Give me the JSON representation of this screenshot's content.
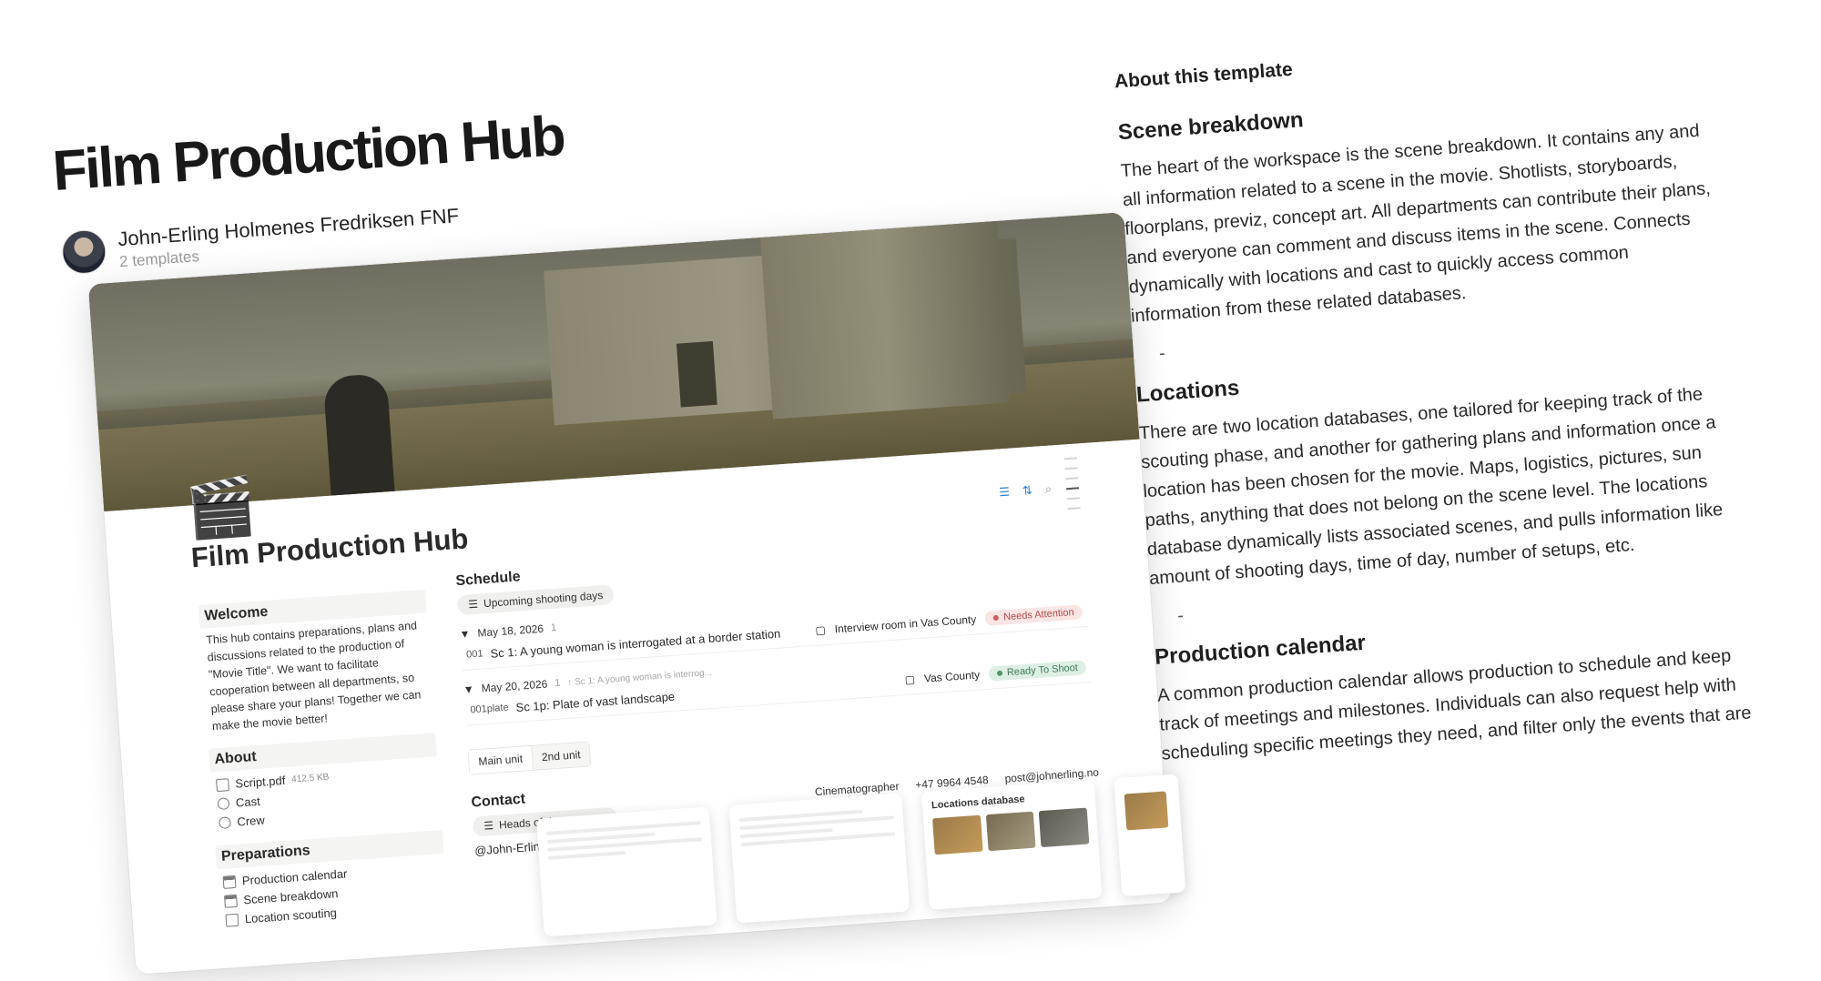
{
  "header": {
    "title": "Film Production Hub",
    "author_name": "John-Erling Holmenes Fredriksen FNF",
    "author_sub": "2 templates"
  },
  "preview": {
    "emoji": "🎬",
    "title": "Film Production Hub",
    "welcome": {
      "heading": "Welcome",
      "text": "This hub contains preparations, plans and discussions related to the production of \"Movie Title\". We want to facilitate cooperation between all departments, so please share your plans! Together we can make the movie better!"
    },
    "about": {
      "heading": "About",
      "items": [
        {
          "label": "Script.pdf",
          "meta": "412.5 KB",
          "icon": "file-icon"
        },
        {
          "label": "Cast",
          "icon": "people-icon"
        },
        {
          "label": "Crew",
          "icon": "people-icon"
        }
      ]
    },
    "preparations": {
      "heading": "Preparations",
      "items": [
        {
          "label": "Production calendar",
          "icon": "calendar-icon"
        },
        {
          "label": "Scene breakdown",
          "icon": "table-icon"
        },
        {
          "label": "Location scouting",
          "icon": "map-icon"
        }
      ]
    },
    "schedule": {
      "heading": "Schedule",
      "view": "Upcoming shooting days",
      "groups": [
        {
          "date": "May 18, 2026",
          "count": "1",
          "row": {
            "code": "001",
            "scene": "Sc 1: A young woman is interrogated at a border station",
            "location": "Interview room in Vas County",
            "status": "Needs Attention"
          }
        },
        {
          "date": "May 20, 2026",
          "count": "1",
          "parent": "↑ Sc 1: A young woman is interrog...",
          "row": {
            "code": "001plate",
            "scene": "Sc 1p: Plate of vast landscape",
            "location": "Vas County",
            "status": "Ready To Shoot"
          }
        }
      ],
      "tabs": [
        "Main unit",
        "2nd unit"
      ]
    },
    "contact": {
      "heading": "Contact",
      "view": "Heads of departments",
      "role": "Cinematographer",
      "phone": "+47 9964 4548",
      "email": "post@johnerling.no",
      "person": "@John-Erling Holmenes Fredriksen"
    },
    "thumb_title": "Locations database"
  },
  "about_template": {
    "heading": "About this template",
    "sections": [
      {
        "title": "Scene breakdown",
        "body": "The heart of the workspace is the scene breakdown. It contains any and all information related to a scene in the movie. Shotlists, storyboards, floorplans, previz, concept art. All departments can contribute their plans, and everyone can comment and discuss items in the scene. Connects dynamically with locations and cast to quickly access common information from these related databases."
      },
      {
        "title": "Locations",
        "body": "There are two location databases, one tailored for keeping track of the scouting phase, and another for gathering plans and information once a location has been chosen for the movie. Maps, logistics, pictures, sun paths, anything that does not belong on the scene level. The locations database dynamically lists associated scenes, and pulls information like amount of shooting days, time of day, number of setups, etc."
      },
      {
        "title": "Production calendar",
        "body": "A common production calendar allows production to schedule and keep track of meetings and milestones. Individuals can also request help with scheduling specific meetings they need, and filter only the events that are"
      }
    ],
    "separator": "-"
  },
  "colors": {
    "accent": "#2b7fd2",
    "needs_attention": "#b44a4a",
    "ready": "#3d7b55"
  }
}
